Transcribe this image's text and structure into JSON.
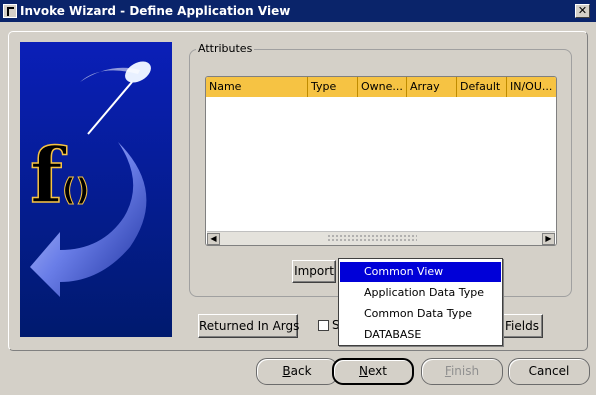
{
  "window": {
    "title": "Invoke Wizard - Define Application View",
    "close_label": "✕"
  },
  "logo": {
    "glyph": "f",
    "parens": "()"
  },
  "attributes": {
    "group_label": "Attributes",
    "columns": [
      "Name",
      "Type",
      "Owne...",
      "Array",
      "Default",
      "IN/OU..."
    ]
  },
  "buttons": {
    "import": "Import",
    "returned_in_args": "Returned In Args",
    "checkbox_label": "S",
    "fields": "Fields"
  },
  "import_menu": {
    "items": [
      "Common View",
      "Application Data Type",
      "Common Data Type",
      "DATABASE"
    ],
    "selected": "Common View"
  },
  "nav": {
    "back": {
      "first": "B",
      "rest": "ack"
    },
    "next": {
      "first": "N",
      "rest": "ext"
    },
    "finish": {
      "first": "F",
      "rest": "inish"
    },
    "cancel": "Cancel"
  },
  "colors": {
    "title_bar": "#0a246a",
    "header": "#f6c343",
    "menu_selected": "#0000d8"
  }
}
